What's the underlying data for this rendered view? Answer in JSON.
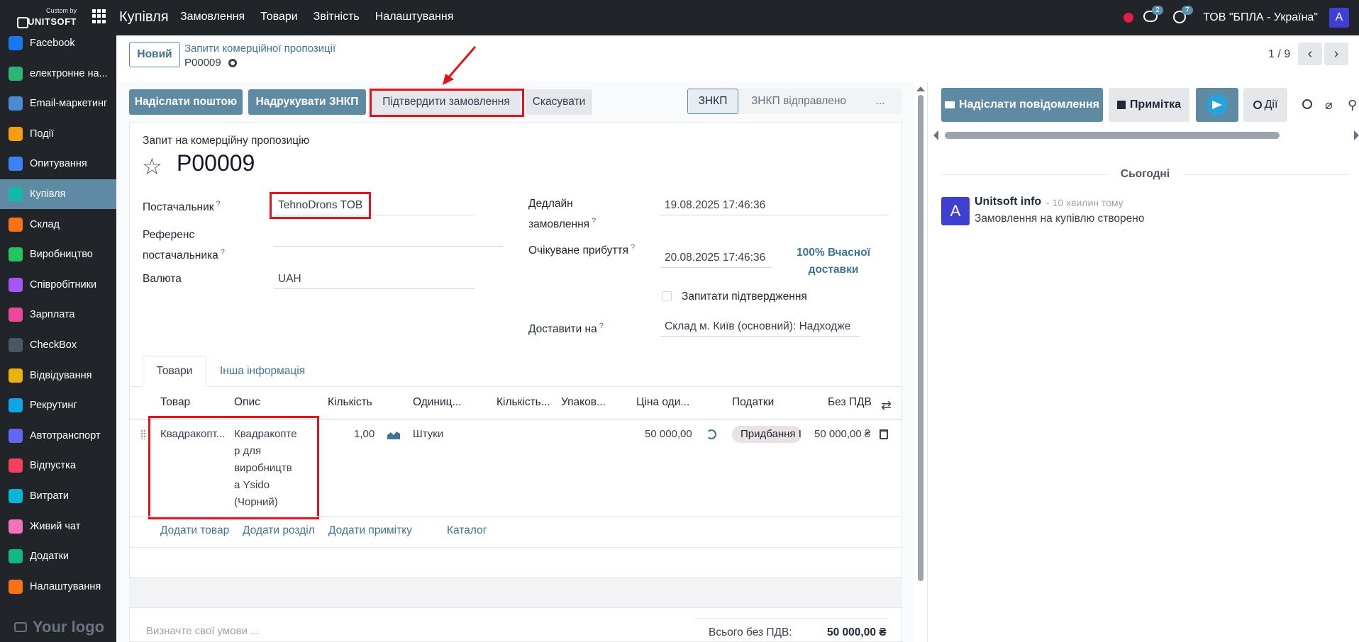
{
  "brand": {
    "line1": "Custom by",
    "line2": "UNITSOFT"
  },
  "app_name": "Купівля",
  "top_menu": [
    "Замовлення",
    "Товари",
    "Звітність",
    "Налаштування"
  ],
  "topbar": {
    "messages_count": "2",
    "activities_count": "7",
    "company": "ТОВ \"БПЛА - Україна\"",
    "avatar_letter": "A"
  },
  "sidebar": {
    "items": [
      {
        "label": "Facebook",
        "color": "#1877f2"
      },
      {
        "label": "електронне на...",
        "color": "#2bb673"
      },
      {
        "label": "Email-маркетинг",
        "color": "#4a8bd6"
      },
      {
        "label": "Події",
        "color": "#f59e0b"
      },
      {
        "label": "Опитування",
        "color": "#3b82f6"
      },
      {
        "label": "Купівля",
        "color": "#14b8a6"
      },
      {
        "label": "Склад",
        "color": "#f97316"
      },
      {
        "label": "Виробництво",
        "color": "#22c55e"
      },
      {
        "label": "Співробітники",
        "color": "#a855f7"
      },
      {
        "label": "Зарплата",
        "color": "#ec4899"
      },
      {
        "label": "CheckBox",
        "color": "#4b5563"
      },
      {
        "label": "Відвідування",
        "color": "#eab308"
      },
      {
        "label": "Рекрутинг",
        "color": "#0ea5e9"
      },
      {
        "label": "Автотранспорт",
        "color": "#6366f1"
      },
      {
        "label": "Відпустка",
        "color": "#f43f5e"
      },
      {
        "label": "Витрати",
        "color": "#06b6d4"
      },
      {
        "label": "Живий чат",
        "color": "#f472b6"
      },
      {
        "label": "Додатки",
        "color": "#10b981"
      },
      {
        "label": "Налаштування",
        "color": "#f97316"
      }
    ],
    "active_index": 5,
    "logo_text": "Your logo"
  },
  "control": {
    "new_label": "Новий",
    "breadcrumb": "Запити комерційної пропозиції",
    "record": "P00009",
    "pager": "1 / 9"
  },
  "actions": {
    "send_email": "Надіслати поштою",
    "print": "Надрукувати ЗНКП",
    "confirm": "Підтвердити замовлення",
    "cancel": "Скасувати"
  },
  "statusbar": [
    "ЗНКП",
    "ЗНКП відправлено",
    "..."
  ],
  "form": {
    "subtitle": "Запит на комерційну пропозицію",
    "name": "P00009",
    "vendor_label": "Постачальник",
    "vendor": "TehnoDrons TOB",
    "vendor_ref_label_1": "Референс",
    "vendor_ref_label_2": "постачальника",
    "currency_label": "Валюта",
    "currency": "UAH",
    "deadline_label_1": "Дедлайн",
    "deadline_label_2": "замовлення",
    "deadline": "19.08.2025 17:46:36",
    "expected_label": "Очікуване прибуття",
    "expected": "20.08.2025 17:46:36",
    "ontime_1": "100% Вчасної",
    "ontime_2": "доставки",
    "ask_confirm": "Запитати підтвердження",
    "deliver_label": "Доставити на",
    "deliver": "Склад м. Київ (основний): Надходже"
  },
  "tabs": [
    "Товари",
    "Інша інформація"
  ],
  "table": {
    "headers": [
      "Товар",
      "Опис",
      "Кількість",
      "Одиниц...",
      "Кількість...",
      "Упаков...",
      "Ціна оди...",
      "Податки",
      "Без ПДВ"
    ],
    "row": {
      "product": "Квадракопт...",
      "description": [
        "Квадракопте",
        "р для",
        "виробництв",
        "а Ysido",
        "(Чорний)"
      ],
      "qty": "1,00",
      "uom": "Штуки",
      "price": "50 000,00",
      "tax": "Придбання І",
      "subtotal": "50 000,00 ₴"
    },
    "add_links": [
      "Додати товар",
      "Додати розділ",
      "Додати примітку",
      "Каталог"
    ]
  },
  "footer": {
    "terms_placeholder": "Визначте свої умови ...",
    "total_label": "Всього без ПДВ:",
    "total_value": "50 000,00 ₴"
  },
  "chatter": {
    "send_message": "Надіслати повідомлення",
    "note": "Примітка",
    "activities": "Дії",
    "today": "Сьогодні",
    "message": {
      "avatar": "A",
      "author": "Unitsoft info",
      "time": "- 10 хвилин тому",
      "body": "Замовлення на купівлю створено"
    }
  },
  "colors": {
    "primary": "#5f8aa3",
    "link": "#3e7594",
    "highlight": "#e4121b"
  }
}
